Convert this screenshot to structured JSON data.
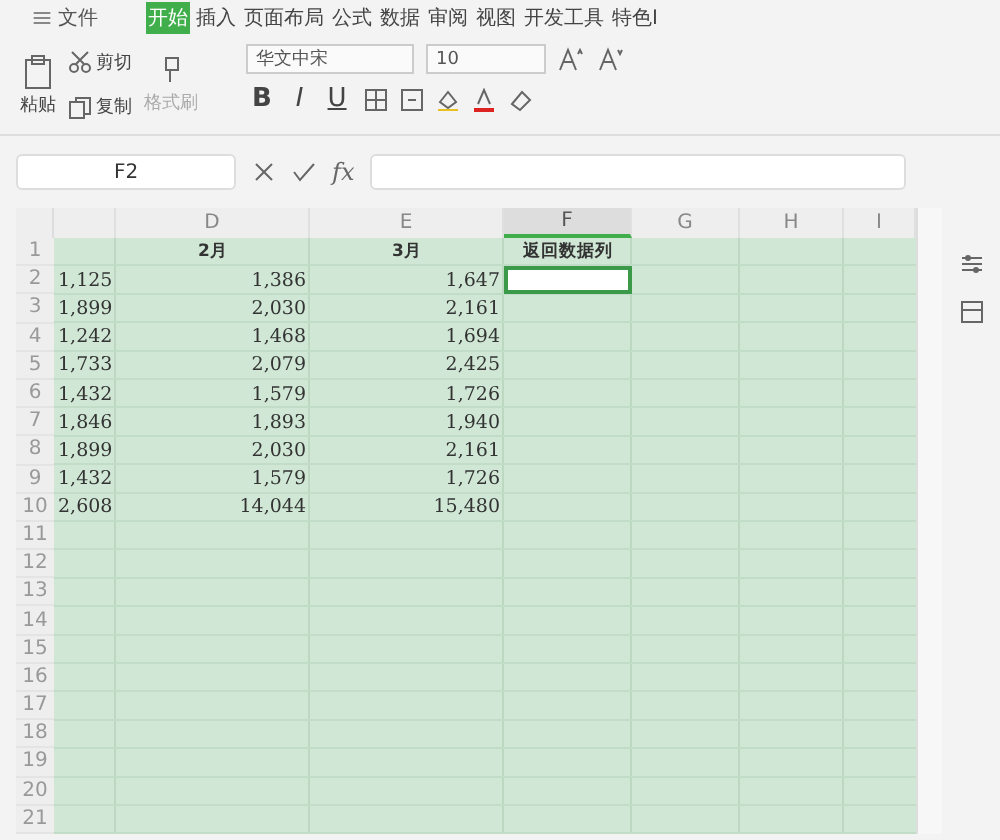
{
  "menu": {
    "file_label": "文件",
    "tabs": [
      {
        "label": "开始",
        "selected": true
      },
      {
        "label": "插入",
        "selected": false
      },
      {
        "label": "页面布局",
        "selected": false
      },
      {
        "label": "公式",
        "selected": false
      },
      {
        "label": "数据",
        "selected": false
      },
      {
        "label": "审阅",
        "selected": false
      },
      {
        "label": "视图",
        "selected": false
      },
      {
        "label": "开发工具",
        "selected": false
      },
      {
        "label": "特色I",
        "selected": false
      }
    ]
  },
  "toolbar": {
    "paste": "粘贴",
    "cut": "剪切",
    "copy": "复制",
    "format_painter": {
      "label": "格式刷",
      "disabled": true
    },
    "font": "华文中宋",
    "size": "10",
    "bold": "B",
    "italic": "I",
    "underline": "U"
  },
  "formula_bar": {
    "cell_ref": "F2",
    "fx": "fx"
  },
  "columns": [
    {
      "label": "D",
      "selected": false
    },
    {
      "label": "E",
      "selected": false
    },
    {
      "label": "F",
      "selected": true
    },
    {
      "label": "G",
      "selected": false
    },
    {
      "label": "H",
      "selected": false
    },
    {
      "label": "I",
      "selected": false
    }
  ],
  "rows": [
    {
      "number": "1",
      "d": "2月",
      "e": "3月",
      "f": "返回数据列",
      "f_selected": false
    },
    {
      "number": "2",
      "c": "1,125",
      "d": "1,386",
      "e": "1,647",
      "f_selected": true
    },
    {
      "number": "3",
      "c": "1,899",
      "d": "2,030",
      "e": "2,161",
      "f_selected": false
    },
    {
      "number": "4",
      "c": "1,242",
      "d": "1,468",
      "e": "1,694",
      "f_selected": false
    },
    {
      "number": "5",
      "c": "1,733",
      "d": "2,079",
      "e": "2,425",
      "f_selected": false
    },
    {
      "number": "6",
      "c": "1,432",
      "d": "1,579",
      "e": "1,726",
      "f_selected": false
    },
    {
      "number": "7",
      "c": "1,846",
      "d": "1,893",
      "e": "1,940",
      "f_selected": false
    },
    {
      "number": "8",
      "c": "1,899",
      "d": "2,030",
      "e": "2,161",
      "f_selected": false
    },
    {
      "number": "9",
      "c": "1,432",
      "d": "1,579",
      "e": "1,726",
      "f_selected": false
    },
    {
      "number": "10",
      "c": "2,608",
      "d": "14,044",
      "e": "15,480",
      "f_selected": false
    },
    {
      "number": "11",
      "f_selected": false
    },
    {
      "number": "12",
      "f_selected": false
    },
    {
      "number": "13",
      "f_selected": false
    },
    {
      "number": "14",
      "f_selected": false
    },
    {
      "number": "15",
      "f_selected": false
    },
    {
      "number": "16",
      "f_selected": false
    },
    {
      "number": "17",
      "f_selected": false
    },
    {
      "number": "18",
      "f_selected": false
    },
    {
      "number": "19",
      "f_selected": false
    },
    {
      "number": "20",
      "f_selected": false
    },
    {
      "number": "21",
      "f_selected": false
    }
  ]
}
